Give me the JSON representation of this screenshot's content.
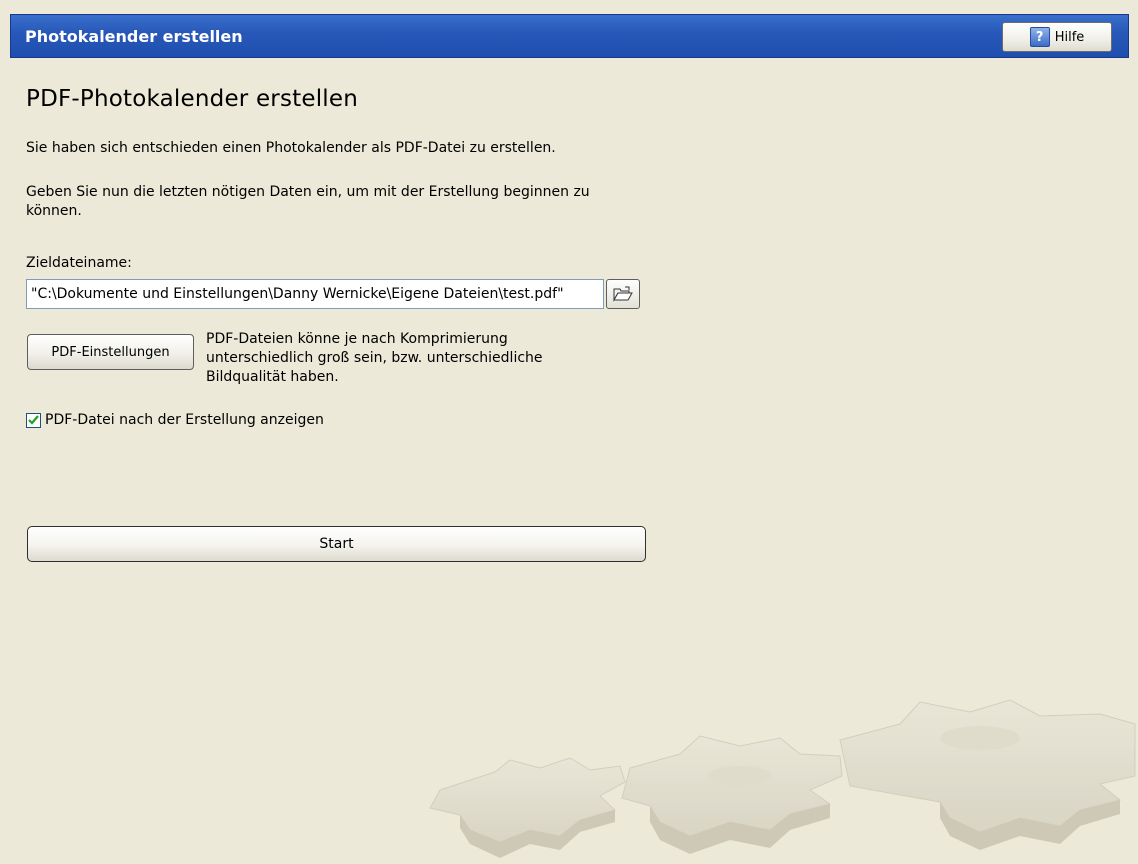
{
  "window": {
    "title": "Photokalender erstellen"
  },
  "toolbar": {
    "help_label": "Hilfe",
    "help_icon": "help-question-icon"
  },
  "main": {
    "heading": "PDF-Photokalender erstellen",
    "intro_line1": "Sie haben sich entschieden einen Photokalender als PDF-Datei zu erstellen.",
    "intro_line2": " Geben Sie nun die letzten nötigen Daten ein, um mit der Erstellung beginnen zu können.",
    "target_label": "Zieldateiname:",
    "target_value": "\"C:\\Dokumente und Einstellungen\\Danny Wernicke\\Eigene Dateien\\test.pdf\"",
    "browse_icon": "open-folder-icon",
    "pdf_settings_label": "PDF-Einstellungen",
    "pdf_settings_desc": "PDF-Dateien könne je nach Komprimierung unterschiedlich groß sein, bzw. unterschiedliche Bildqualität haben.",
    "show_pdf_label": "PDF-Datei nach der Erstellung anzeigen",
    "show_pdf_checked": true,
    "start_label": "Start"
  },
  "decoration": {
    "background_graphic": "gears-graphic"
  },
  "colors": {
    "titlebar": "#2757b8",
    "background": "#ece9d8",
    "check": "#21a121"
  }
}
